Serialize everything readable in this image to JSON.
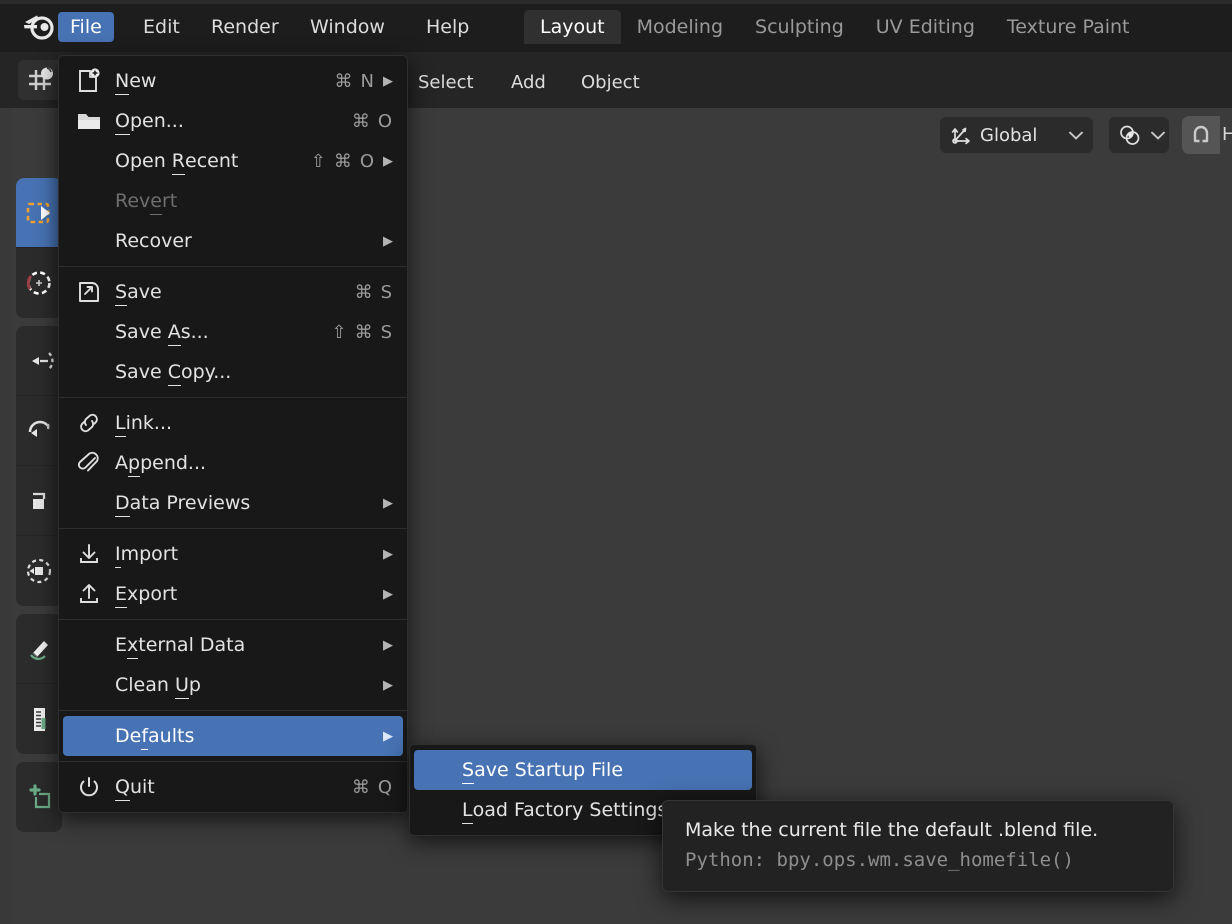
{
  "app": {
    "name": "Blender",
    "logo_icon": "blender-logo-icon"
  },
  "topbar": {
    "menus": [
      {
        "label": "File",
        "active": true
      },
      {
        "label": "Edit",
        "active": false
      },
      {
        "label": "Render",
        "active": false
      },
      {
        "label": "Window",
        "active": false
      },
      {
        "label": "Help",
        "active": false
      }
    ],
    "workspace_tabs": [
      {
        "label": "Layout",
        "active": true
      },
      {
        "label": "Modeling",
        "active": false
      },
      {
        "label": "Sculpting",
        "active": false
      },
      {
        "label": "UV Editing",
        "active": false
      },
      {
        "label": "Texture Paint",
        "active": false
      }
    ]
  },
  "header": {
    "editor_type_icon": "editor-type-3d-viewport-icon",
    "menus": [
      "Select",
      "Add",
      "Object"
    ],
    "transform_orientation": {
      "label": "Global",
      "icon": "orientation-axis-icon",
      "chevron": "chevron-down-icon"
    },
    "pivot_point": {
      "icon": "pivot-point-icon",
      "chevron": "chevron-down-icon"
    },
    "snap": {
      "icon": "magnet-icon",
      "label": "H",
      "enabled": true
    }
  },
  "toolbar": {
    "tools": [
      {
        "name": "tweak-select-box",
        "icon": "select-box-icon",
        "selected": true
      },
      {
        "name": "cursor",
        "icon": "cursor-icon",
        "selected": false
      },
      {
        "name": "move",
        "icon": "move-icon",
        "selected": false
      },
      {
        "name": "rotate",
        "icon": "rotate-icon",
        "selected": false
      },
      {
        "name": "scale",
        "icon": "scale-icon",
        "selected": false
      },
      {
        "name": "transform",
        "icon": "transform-icon",
        "selected": false
      },
      {
        "name": "annotate",
        "icon": "annotate-icon",
        "selected": false
      },
      {
        "name": "measure",
        "icon": "measure-icon",
        "selected": false
      },
      {
        "name": "add-cube",
        "icon": "add-cube-icon",
        "selected": false
      }
    ]
  },
  "file_menu": {
    "items": [
      {
        "label": "New",
        "accel": "N",
        "icon": "new-file-icon",
        "shortcut": [
          "⌘",
          "N"
        ],
        "submenu": true,
        "disabled": false,
        "highlighted": false
      },
      {
        "label": "Open...",
        "accel": "O",
        "icon": "folder-icon",
        "shortcut": [
          "⌘",
          "O"
        ],
        "submenu": false,
        "disabled": false,
        "highlighted": false
      },
      {
        "label": "Open Recent",
        "accel": "R",
        "icon": "",
        "shortcut": [
          "⇧",
          "⌘",
          "O"
        ],
        "submenu": true,
        "disabled": false,
        "highlighted": false
      },
      {
        "label": "Revert",
        "accel": "e",
        "icon": "",
        "shortcut": [],
        "submenu": false,
        "disabled": true,
        "highlighted": false
      },
      {
        "label": "Recover",
        "accel": "",
        "icon": "",
        "shortcut": [],
        "submenu": true,
        "disabled": false,
        "highlighted": false
      },
      {
        "separator": true
      },
      {
        "label": "Save",
        "accel": "S",
        "icon": "save-icon",
        "shortcut": [
          "⌘",
          "S"
        ],
        "submenu": false,
        "disabled": false,
        "highlighted": false
      },
      {
        "label": "Save As...",
        "accel": "A",
        "icon": "",
        "shortcut": [
          "⇧",
          "⌘",
          "S"
        ],
        "submenu": false,
        "disabled": false,
        "highlighted": false
      },
      {
        "label": "Save Copy...",
        "accel": "C",
        "icon": "",
        "shortcut": [],
        "submenu": false,
        "disabled": false,
        "highlighted": false
      },
      {
        "separator": true
      },
      {
        "label": "Link...",
        "accel": "L",
        "icon": "link-icon",
        "shortcut": [],
        "submenu": false,
        "disabled": false,
        "highlighted": false
      },
      {
        "label": "Append...",
        "accel": "p",
        "icon": "paperclip-icon",
        "shortcut": [],
        "submenu": false,
        "disabled": false,
        "highlighted": false
      },
      {
        "label": "Data Previews",
        "accel": "D",
        "icon": "",
        "shortcut": [],
        "submenu": true,
        "disabled": false,
        "highlighted": false
      },
      {
        "separator": true
      },
      {
        "label": "Import",
        "accel": "I",
        "icon": "import-icon",
        "shortcut": [],
        "submenu": true,
        "disabled": false,
        "highlighted": false
      },
      {
        "label": "Export",
        "accel": "E",
        "icon": "export-icon",
        "shortcut": [],
        "submenu": true,
        "disabled": false,
        "highlighted": false
      },
      {
        "separator": true
      },
      {
        "label": "External Data",
        "accel": "x",
        "icon": "",
        "shortcut": [],
        "submenu": true,
        "disabled": false,
        "highlighted": false
      },
      {
        "label": "Clean Up",
        "accel": "U",
        "icon": "",
        "shortcut": [],
        "submenu": true,
        "disabled": false,
        "highlighted": false
      },
      {
        "separator": true
      },
      {
        "label": "Defaults",
        "accel": "f",
        "icon": "",
        "shortcut": [],
        "submenu": true,
        "disabled": false,
        "highlighted": true
      },
      {
        "separator": true
      },
      {
        "label": "Quit",
        "accel": "Q",
        "icon": "power-icon",
        "shortcut": [
          "⌘",
          "Q"
        ],
        "submenu": false,
        "disabled": false,
        "highlighted": false
      }
    ]
  },
  "defaults_submenu": {
    "items": [
      {
        "label": "Save Startup File",
        "accel": "S",
        "highlighted": true
      },
      {
        "label": "Load Factory Settings",
        "accel": "L",
        "highlighted": false
      }
    ]
  },
  "tooltip": {
    "description": "Make the current file the default .blend file.",
    "python": "Python: bpy.ops.wm.save_homefile()"
  },
  "colors": {
    "accent_blue": "#4772b3",
    "menu_bg": "#181818",
    "topbar_bg": "#1d1d1d",
    "header_bg": "#252525",
    "viewport_bg": "#3b3b3b",
    "tooltip_bg": "#222222"
  }
}
